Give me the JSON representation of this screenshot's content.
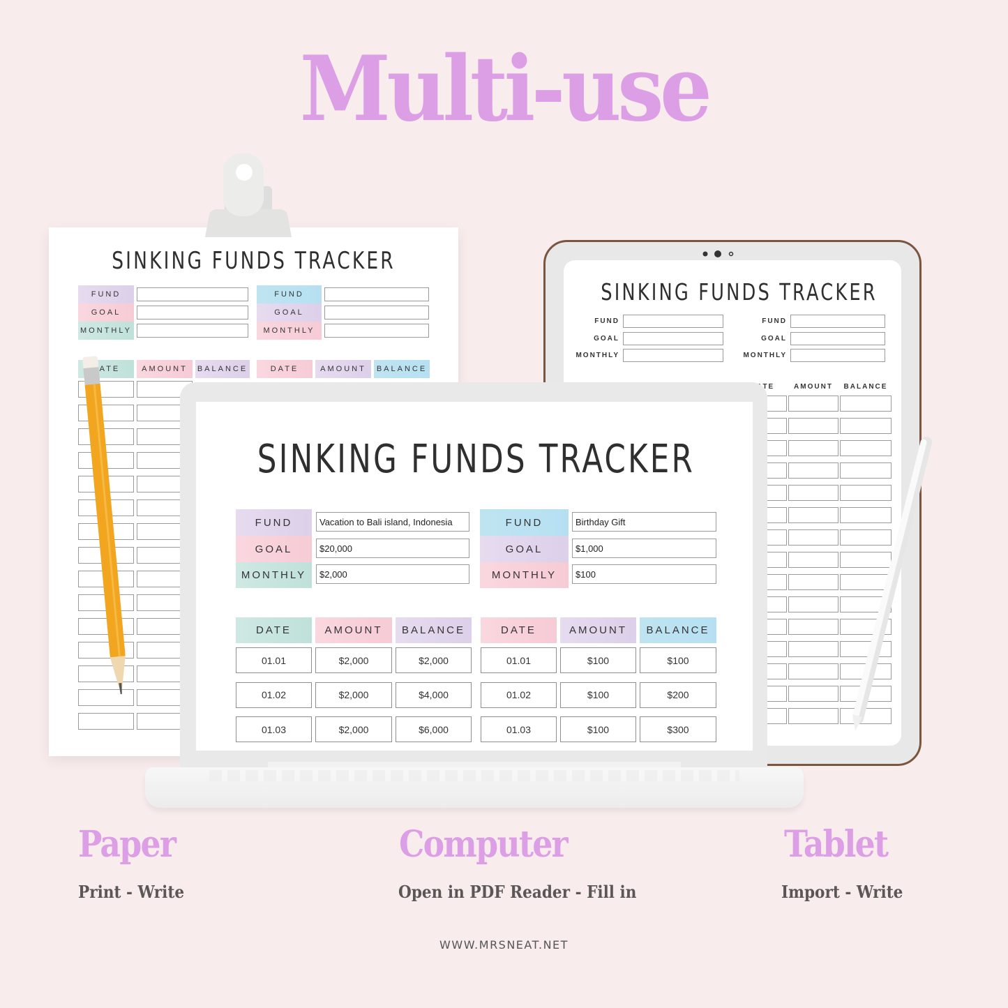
{
  "headline": "Multi-use",
  "tracker_title": "SINKING FUNDS TRACKER",
  "labels": {
    "fund": "FUND",
    "goal": "GOAL",
    "monthly": "MONTHLY",
    "date": "DATE",
    "amount": "AMOUNT",
    "balance": "BALANCE"
  },
  "computer": {
    "fund1": {
      "fund": "Vacation to Bali island, Indonesia",
      "goal": "$20,000",
      "monthly": "$2,000"
    },
    "fund2": {
      "fund": "Birthday Gift",
      "goal": "$1,000",
      "monthly": "$100"
    },
    "table1": [
      {
        "date": "01.01",
        "amount": "$2,000",
        "balance": "$2,000"
      },
      {
        "date": "01.02",
        "amount": "$2,000",
        "balance": "$4,000"
      },
      {
        "date": "01.03",
        "amount": "$2,000",
        "balance": "$6,000"
      }
    ],
    "table2": [
      {
        "date": "01.01",
        "amount": "$100",
        "balance": "$100"
      },
      {
        "date": "01.02",
        "amount": "$100",
        "balance": "$200"
      },
      {
        "date": "01.03",
        "amount": "$100",
        "balance": "$300"
      }
    ]
  },
  "captions": [
    {
      "title": "Paper",
      "subtitle": "Print - Write"
    },
    {
      "title": "Computer",
      "subtitle": "Open in PDF Reader - Fill in"
    },
    {
      "title": "Tablet",
      "subtitle": "Import - Write"
    }
  ],
  "website": "WWW.MRSNEAT.NET",
  "colors": {
    "background": "#f8ecec",
    "accent": "#dc9fe6",
    "tablet_frame": "#7a5540",
    "pencil": "#f2a51f"
  }
}
